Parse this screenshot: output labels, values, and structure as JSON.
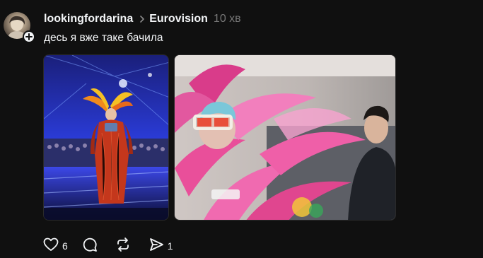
{
  "post": {
    "username": "lookingfordarina",
    "community": "Eurovision",
    "time": "10 хв",
    "caption": "десь я вже таке бачила",
    "media": [
      {
        "kind": "photo",
        "subject": "stage performer in red feathered costume"
      },
      {
        "kind": "photo",
        "subject": "person in pink feathered costume in car"
      }
    ]
  },
  "actions": {
    "like_count": "6",
    "comment_count": "",
    "repost_count": "",
    "share_count": "1"
  },
  "icons": {
    "avatar": "avatar",
    "follow": "plus-icon",
    "separator": "chevron-right-icon",
    "like": "heart-icon",
    "comment": "comment-bubble-icon",
    "repost": "repost-icon",
    "share": "send-icon"
  },
  "colors": {
    "background": "#101010",
    "text_primary": "#f3f5f7",
    "text_secondary": "#777777"
  }
}
